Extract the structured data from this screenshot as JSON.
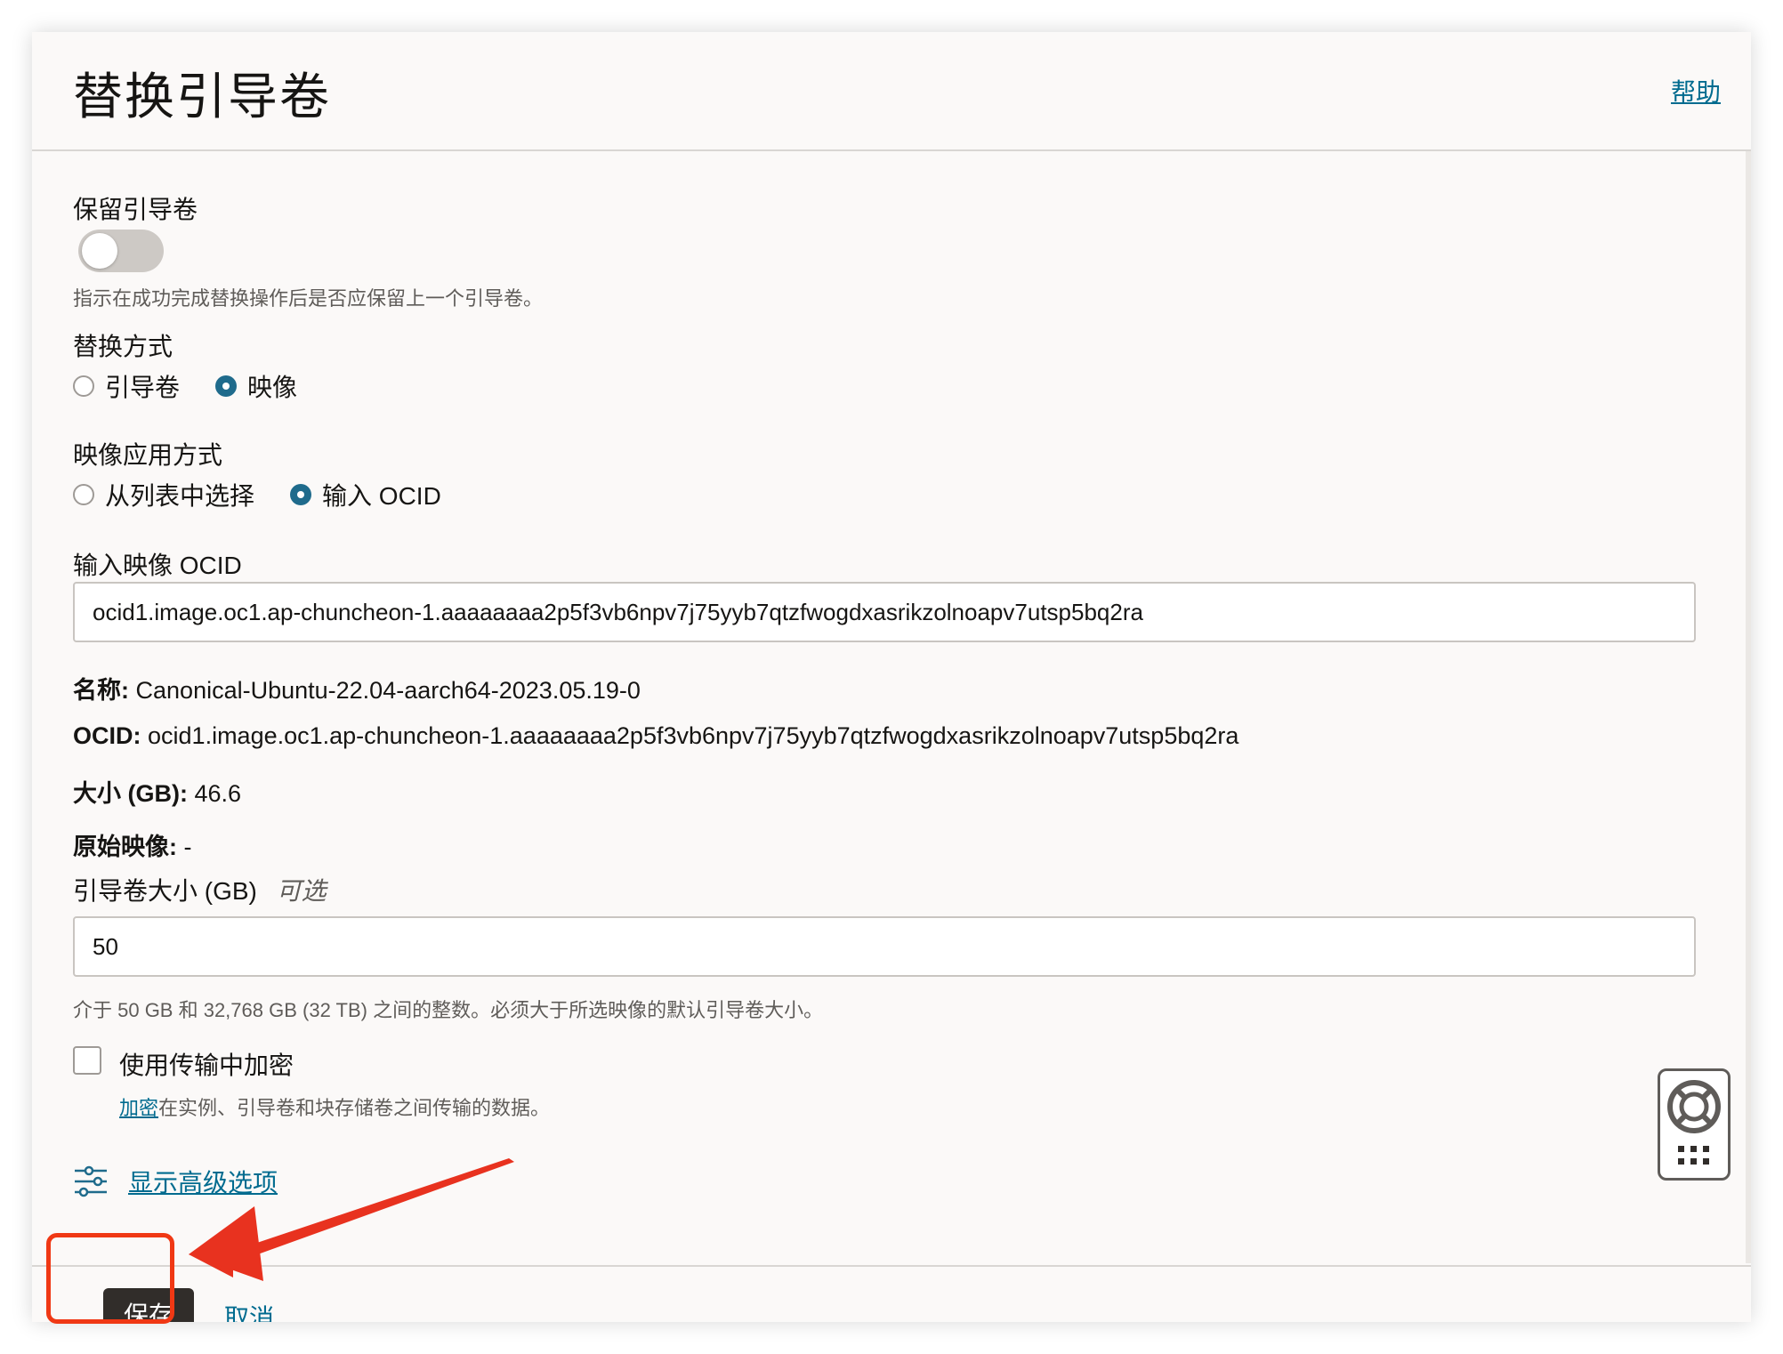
{
  "header": {
    "title": "替换引导卷",
    "help": "帮助"
  },
  "preserve": {
    "label": "保留引导卷",
    "hint": "指示在成功完成替换操作后是否应保留上一个引导卷。",
    "toggle_on": false
  },
  "replace_by": {
    "label": "替换方式",
    "options": [
      "引导卷",
      "映像"
    ],
    "selected": "映像"
  },
  "image_apply": {
    "label": "映像应用方式",
    "options": [
      "从列表中选择",
      "输入 OCID"
    ],
    "selected": "输入 OCID"
  },
  "image_ocid": {
    "label": "输入映像 OCID",
    "value": "ocid1.image.oc1.ap-chuncheon-1.aaaaaaaa2p5f3vb6npv7j75yyb7qtzfwogdxasrikzolnoapv7utsp5bq2ra"
  },
  "image_info": {
    "name_key": "名称:",
    "name_value": "Canonical-Ubuntu-22.04-aarch64-2023.05.19-0",
    "ocid_key": "OCID:",
    "ocid_value": "ocid1.image.oc1.ap-chuncheon-1.aaaaaaaa2p5f3vb6npv7j75yyb7qtzfwogdxasrikzolnoapv7utsp5bq2ra",
    "size_key": "大小 (GB):",
    "size_value": "46.6",
    "origin_key": "原始映像:",
    "origin_value": "-"
  },
  "boot_size": {
    "label": "引导卷大小 (GB)",
    "optional": "可选",
    "value": "50",
    "hint": "介于 50 GB 和 32,768 GB (32 TB) 之间的整数。必须大于所选映像的默认引导卷大小。"
  },
  "encryption": {
    "label": "使用传输中加密",
    "checked": false,
    "link": "加密",
    "hint": "在实例、引导卷和块存储卷之间传输的数据。"
  },
  "advanced": {
    "label": "显示高级选项"
  },
  "footer": {
    "save": "保存",
    "cancel": "取消"
  },
  "colors": {
    "accent": "#1f6b8c",
    "link": "#006b8f",
    "highlight": "#f03814",
    "button": "#312d2a"
  }
}
